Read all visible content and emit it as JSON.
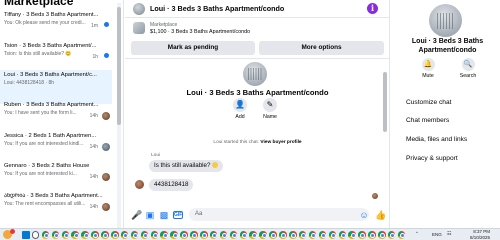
{
  "left": {
    "title": "Marketplace",
    "conversations": [
      {
        "name": "Tiffany · 3 Beds 3 Baths Apartment...",
        "snippet": "You: Ok please send me your credi...",
        "time": "1m",
        "unread": true
      },
      {
        "name": "Tsion · 3 Beds 3 Baths Apartment/...",
        "snippet": "Tsion: Is this still available? 😊",
        "time": "1h",
        "unread": true
      },
      {
        "name": "Loui · 3 Beds 3 Baths Apartment/c...",
        "snippet": "Loui: 4438128418 · 8h",
        "time": "",
        "unread": false
      },
      {
        "name": "Ruben · 3 Beds 3 Baths Apartment...",
        "snippet": "You: I have sent you the form li...",
        "time": "14h",
        "unread": false
      },
      {
        "name": "Jessica · 2 Beds 1 Bath Apartmen...",
        "snippet": "You: If you are not interested kindl...",
        "time": "14h",
        "unread": false
      },
      {
        "name": "Gennaro · 3 Beds 2 Baths House",
        "snippet": "You: If you are not interested ki...",
        "time": "14h",
        "unread": false
      },
      {
        "name": "ანდრია · 3 Beds 3 Baths Apartment...",
        "snippet": "You: The rent encompasses all utili...",
        "time": "14h",
        "unread": false
      }
    ]
  },
  "chat": {
    "title": "Loui · 3 Beds 3 Baths Apartment/condo",
    "info_icon": "i",
    "marketplace_label": "Marketplace",
    "listing_price": "$1,100 · 3 Beds 3 Baths Apartment/condo",
    "mark_pending": "Mark as pending",
    "more_options": "More options",
    "thread_title": "Loui · 3 Beds 3 Baths Apartment/condo",
    "add_label": "Add",
    "name_label": "Name",
    "started_text": "Loui started this chat.",
    "view_profile": "View buyer profile",
    "sender_name": "Loui",
    "messages": [
      "Is this still available?",
      "4438128418"
    ],
    "input_placeholder": "Aa"
  },
  "right": {
    "name": "Loui · 3 Beds 3 Baths Apartment/condo",
    "mute_label": "Mute",
    "search_label": "Search",
    "menu": [
      "Customize chat",
      "Chat members",
      "Media, files and links",
      "Privacy & support"
    ]
  },
  "taskbar": {
    "lang": "ENG",
    "time": "8:37 PM",
    "date": "8/10/2025"
  },
  "colors": {
    "accent": "#1877f2",
    "info": "#8a2be2",
    "active_row": "#e7f3ff"
  }
}
